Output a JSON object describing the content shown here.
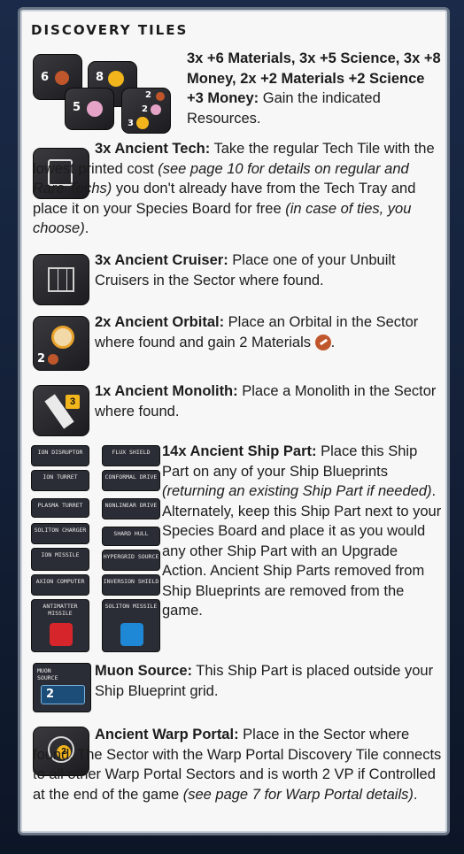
{
  "heading": "DISCOVERY TILES",
  "sections": {
    "resources": {
      "bold": "3x +6 Materials, 3x +5 Science, 3x +8 Money, 2x +2 Materials +2 Science +3 Money:",
      "text": " Gain the indicated Resources.",
      "tile_values": [
        "6",
        "8",
        "5",
        "2",
        "2",
        "3"
      ]
    },
    "ancient_tech": {
      "bold": "3x Ancient Tech:",
      "text1": " Take the regular Tech Tile with the lowest printed cost ",
      "italic1": "(see page 10 for details on regular and Rare Techs)",
      "text2": " you don't already have from the Tech Tray and place it on your Species Board for free ",
      "italic2": "(in case of ties, you choose)",
      "text3": "."
    },
    "ancient_cruiser": {
      "bold": "3x Ancient Cruiser:",
      "text": " Place one of your Unbuilt Cruisers in the Sector where found."
    },
    "ancient_orbital": {
      "bold": "2x Ancient Orbital:",
      "text": " Place an Orbital in the Sector where found and gain 2 Materials",
      "text_end": ".",
      "tile_value": "2"
    },
    "ancient_monolith": {
      "bold": "1x Ancient Monolith:",
      "text": " Place a Monolith in the Sector where found.",
      "tile_value": "3"
    },
    "ancient_ship_part": {
      "bold": "14x Ancient Ship Part:",
      "text1": " Place this Ship Part on any of your Ship Blueprints ",
      "italic1": "(returning an existing Ship Part if needed)",
      "text2": ". Alternately, keep this Ship Part next to your Species Board and place it as you would any other Ship Part with an Upgrade Action. Ancient Ship Parts removed from Ship Blueprints are removed from the game.",
      "parts_left": [
        "ION DISRUPTOR",
        "ION TURRET",
        "PLASMA TURRET",
        "SOLITON CHARGER",
        "ION MISSILE",
        "AXION COMPUTER",
        "ANTIMATTER MISSILE"
      ],
      "parts_right": [
        "FLUX SHIELD",
        "CONFORMAL DRIVE",
        "NONLINEAR DRIVE",
        "SHARD HULL",
        "HYPERGRID SOURCE",
        "INVERSION SHIELD",
        "SOLITON MISSILE"
      ]
    },
    "muon_source": {
      "bold": "Muon Source:",
      "text": " This Ship Part is placed outside your Ship Blueprint grid.",
      "tile_label": "MUON SOURCE",
      "tile_value": "2"
    },
    "warp_portal": {
      "bold": "Ancient Warp Portal:",
      "text1": " Place in the Sector where found. The Sector with the Warp Portal Discovery Tile connects to all other Warp Portal Sectors and is worth 2 VP if Controlled at the end of the game ",
      "italic1": "(see page 7 for Warp Portal details)",
      "text2": ".",
      "tile_value": "2"
    }
  },
  "colors": {
    "materials": "#c0562b",
    "science": "#e6a3c8",
    "money": "#f2b51c",
    "panel_bg": "#f7f7f7",
    "panel_border": "#6a7686"
  }
}
